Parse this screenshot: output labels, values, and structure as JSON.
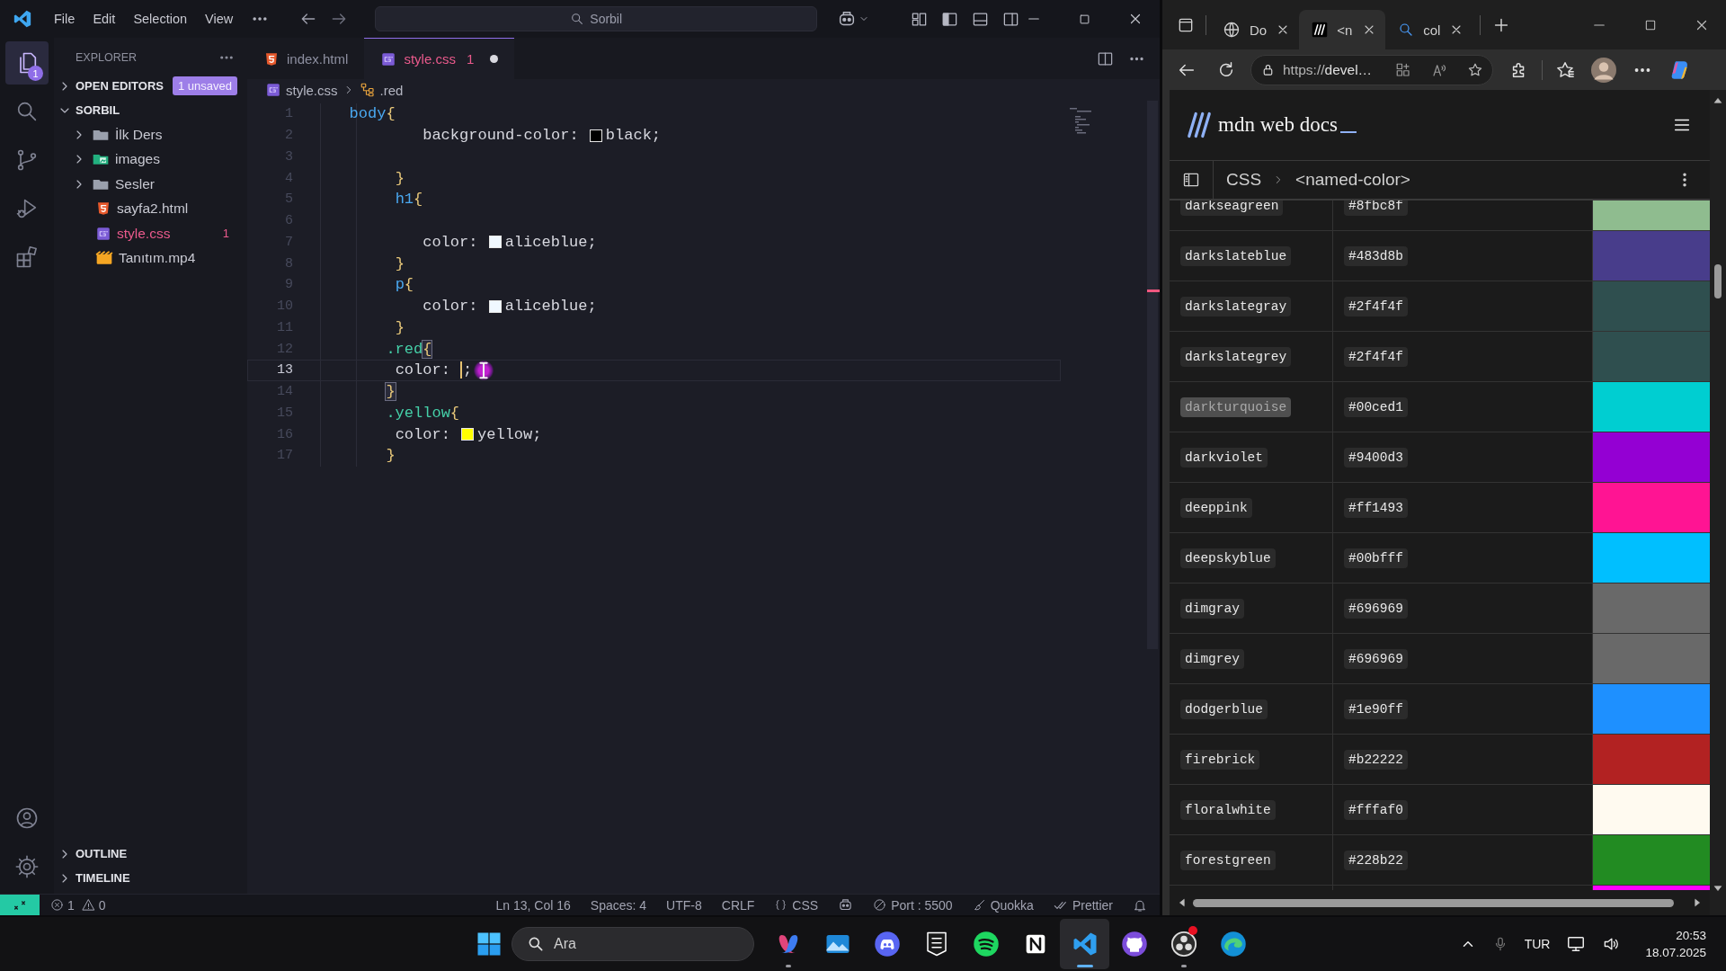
{
  "vscode": {
    "menu": [
      "File",
      "Edit",
      "Selection",
      "View"
    ],
    "command_center": {
      "text": "Sorbil"
    },
    "activity_bar": [
      {
        "kind": "explorer",
        "selected": true,
        "badge": "1"
      },
      {
        "kind": "search",
        "selected": false
      },
      {
        "kind": "source-control",
        "selected": false
      },
      {
        "kind": "run-debug",
        "selected": false
      },
      {
        "kind": "extensions",
        "selected": false
      }
    ],
    "activity_bar_bottom": [
      {
        "kind": "account"
      },
      {
        "kind": "settings"
      }
    ],
    "sidebar": {
      "title": "EXPLORER",
      "sections": [
        {
          "title": "OPEN EDITORS",
          "expanded": false,
          "badge": "1 unsaved"
        },
        {
          "title": "SORBIL",
          "expanded": true,
          "children": [
            {
              "name": "İlk Ders",
              "kind": "folder",
              "expanded": false
            },
            {
              "name": "images",
              "kind": "image-folder",
              "expanded": false
            },
            {
              "name": "Sesler",
              "kind": "folder",
              "expanded": false
            },
            {
              "name": "sayfa2.html",
              "kind": "html",
              "error": false
            },
            {
              "name": "style.css",
              "kind": "css",
              "error": true,
              "problems": "1"
            },
            {
              "name": "Tanıtım.mp4",
              "kind": "video",
              "error": false
            }
          ]
        }
      ],
      "panels": [
        {
          "title": "OUTLINE",
          "expanded": false
        },
        {
          "title": "TIMELINE",
          "expanded": false
        }
      ]
    },
    "tabs": [
      {
        "label": "index.html",
        "kind": "html",
        "selected": false,
        "modified": false
      },
      {
        "label": "style.css",
        "kind": "css",
        "selected": true,
        "modified": true,
        "problems": "1"
      }
    ],
    "breadcrumb": [
      {
        "label": "style.css",
        "kind": "css"
      },
      {
        "label": ".red",
        "kind": "selector"
      }
    ],
    "code": [
      {
        "number": "1",
        "current": false,
        "tokens": [
          {
            "kind": "selector",
            "text": "   body"
          },
          {
            "kind": "brace",
            "text": "{",
            "matched": false
          }
        ]
      },
      {
        "number": "2",
        "current": false,
        "tokens": [
          {
            "kind": "property",
            "text": "           background-color: "
          },
          {
            "kind": "swatch",
            "color": "#000000"
          },
          {
            "kind": "value",
            "text": "black;"
          }
        ]
      },
      {
        "number": "3",
        "current": false
      },
      {
        "number": "4",
        "current": false,
        "tokens": [
          {
            "kind": "brace",
            "text": "        }",
            "matched": false
          }
        ]
      },
      {
        "number": "5",
        "current": false,
        "tokens": [
          {
            "kind": "selector",
            "text": "        h1"
          },
          {
            "kind": "brace",
            "text": "{",
            "matched": false
          }
        ]
      },
      {
        "number": "6",
        "current": false
      },
      {
        "number": "7",
        "current": false,
        "tokens": [
          {
            "kind": "property",
            "text": "           color: "
          },
          {
            "kind": "swatch",
            "color": "#f0f8ff"
          },
          {
            "kind": "value",
            "text": "aliceblue;"
          }
        ]
      },
      {
        "number": "8",
        "current": false,
        "tokens": [
          {
            "kind": "brace",
            "text": "        }",
            "matched": false
          }
        ]
      },
      {
        "number": "9",
        "current": false,
        "tokens": [
          {
            "kind": "selector",
            "text": "        p"
          },
          {
            "kind": "brace",
            "text": "{",
            "matched": false
          }
        ]
      },
      {
        "number": "10",
        "current": false,
        "tokens": [
          {
            "kind": "property",
            "text": "           color: "
          },
          {
            "kind": "swatch",
            "color": "#f0f8ff"
          },
          {
            "kind": "value",
            "text": "aliceblue;"
          }
        ]
      },
      {
        "number": "11",
        "current": false,
        "tokens": [
          {
            "kind": "brace",
            "text": "        }",
            "matched": false
          }
        ]
      },
      {
        "number": "12",
        "current": false,
        "tokens": [
          {
            "kind": "class",
            "text": "       .red"
          },
          {
            "kind": "brace",
            "text": "{",
            "matched": true
          }
        ]
      },
      {
        "number": "13",
        "current": true,
        "tokens": [
          {
            "kind": "property",
            "text": "        color: "
          },
          {
            "kind": "caret"
          },
          {
            "kind": "punct",
            "text": ";"
          },
          {
            "kind": "pointer"
          }
        ]
      },
      {
        "number": "14",
        "current": false,
        "tokens": [
          {
            "kind": "brace",
            "text": "       }",
            "matched": true
          }
        ]
      },
      {
        "number": "15",
        "current": false,
        "tokens": [
          {
            "kind": "class",
            "text": "       .yellow"
          },
          {
            "kind": "brace",
            "text": "{",
            "matched": false
          }
        ]
      },
      {
        "number": "16",
        "current": false,
        "tokens": [
          {
            "kind": "property",
            "text": "        color: "
          },
          {
            "kind": "swatch",
            "color": "#ffff00"
          },
          {
            "kind": "value",
            "text": "yellow;"
          }
        ]
      },
      {
        "number": "17",
        "current": false,
        "tokens": [
          {
            "kind": "brace",
            "text": "       }",
            "matched": false
          }
        ]
      }
    ],
    "status_bar": {
      "errors": "1",
      "warnings": "0",
      "items": [
        {
          "kind": "text",
          "text": "Ln 13, Col 16"
        },
        {
          "kind": "text",
          "text": "Spaces: 4"
        },
        {
          "kind": "text",
          "text": "UTF-8"
        },
        {
          "kind": "text",
          "text": "CRLF"
        },
        {
          "kind": "language",
          "text": "CSS"
        },
        {
          "kind": "copilot"
        },
        {
          "kind": "port",
          "text": "Port : 5500"
        },
        {
          "kind": "quokka",
          "text": "Quokka"
        },
        {
          "kind": "prettier",
          "text": "Prettier"
        },
        {
          "kind": "notifications"
        }
      ]
    }
  },
  "browser": {
    "tabs": [
      {
        "label": "Do",
        "kind": "globe",
        "selected": false
      },
      {
        "label": "<n",
        "kind": "site",
        "selected": true
      },
      {
        "label": "col",
        "kind": "search",
        "selected": false
      }
    ],
    "url": {
      "scheme": "https://",
      "rest": "devel…"
    },
    "site_title": "mdn web docs",
    "breadcrumb": [
      "CSS",
      "<named-color>"
    ],
    "colors": [
      {
        "name": "darkseagreen",
        "hex": "#8fbc8f",
        "color": "#8fbc8f"
      },
      {
        "name": "darkslateblue",
        "hex": "#483d8b",
        "color": "#483d8b"
      },
      {
        "name": "darkslategray",
        "hex": "#2f4f4f",
        "color": "#2f4f4f"
      },
      {
        "name": "darkslategrey",
        "hex": "#2f4f4f",
        "color": "#2f4f4f"
      },
      {
        "name": "darkturquoise",
        "hex": "#00ced1",
        "color": "#00ced1",
        "highlighted": true
      },
      {
        "name": "darkviolet",
        "hex": "#9400d3",
        "color": "#9400d3"
      },
      {
        "name": "deeppink",
        "hex": "#ff1493",
        "color": "#ff1493"
      },
      {
        "name": "deepskyblue",
        "hex": "#00bfff",
        "color": "#00bfff"
      },
      {
        "name": "dimgray",
        "hex": "#696969",
        "color": "#696969"
      },
      {
        "name": "dimgrey",
        "hex": "#696969",
        "color": "#696969"
      },
      {
        "name": "dodgerblue",
        "hex": "#1e90ff",
        "color": "#1e90ff"
      },
      {
        "name": "firebrick",
        "hex": "#b22222",
        "color": "#b22222"
      },
      {
        "name": "floralwhite",
        "hex": "#fffaf0",
        "color": "#fffaf0"
      },
      {
        "name": "forestgreen",
        "hex": "#228b22",
        "color": "#228b22"
      },
      {
        "color": "#ff00ff"
      }
    ]
  },
  "taskbar": {
    "search": {
      "placeholder": "Ara"
    },
    "apps": [
      {
        "kind": "copilot",
        "running": true,
        "active": false
      },
      {
        "kind": "photos",
        "active": false
      },
      {
        "kind": "discord",
        "active": false
      },
      {
        "kind": "epic",
        "active": false
      },
      {
        "kind": "spotify",
        "active": false
      },
      {
        "kind": "notion",
        "active": false
      },
      {
        "kind": "vscode",
        "running": true,
        "active": true
      },
      {
        "kind": "github",
        "active": false
      },
      {
        "kind": "obs",
        "running": true,
        "active": false,
        "alert": true
      },
      {
        "kind": "edge",
        "active": false
      }
    ],
    "language": "TUR",
    "time": "20:53",
    "date": "18.07.2025"
  }
}
